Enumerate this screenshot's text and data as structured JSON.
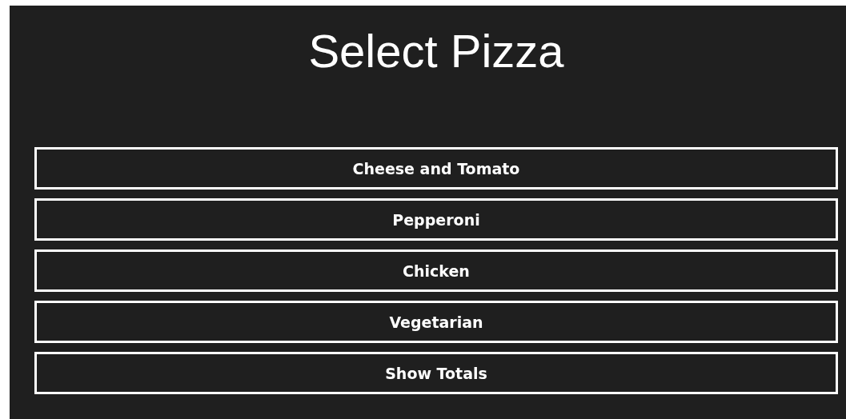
{
  "title": "Select Pizza",
  "buttons": [
    {
      "label": "Cheese and Tomato"
    },
    {
      "label": "Pepperoni"
    },
    {
      "label": "Chicken"
    },
    {
      "label": "Vegetarian"
    },
    {
      "label": "Show Totals"
    }
  ]
}
